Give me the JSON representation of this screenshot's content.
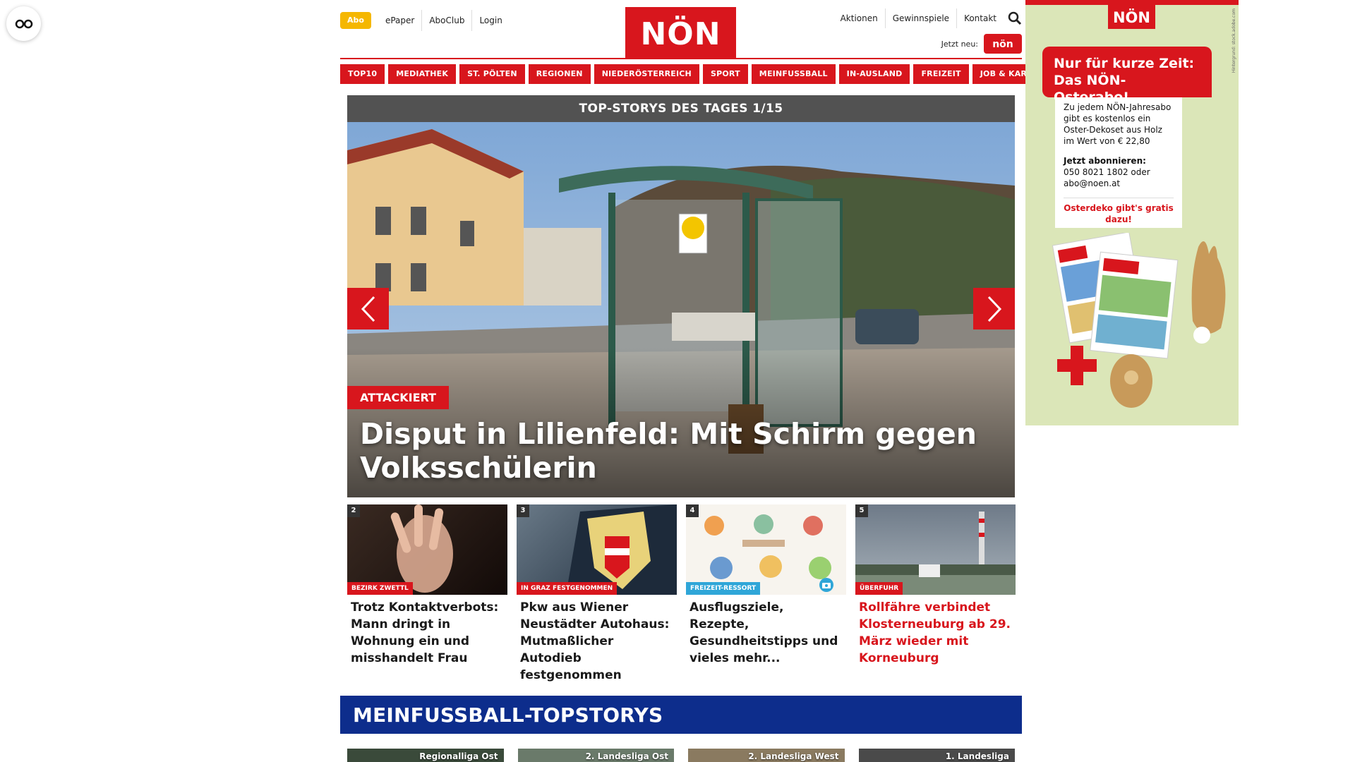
{
  "header": {
    "abo": "Abo",
    "util_links": [
      "ePaper",
      "AboClub",
      "Login"
    ],
    "logo": "NÖN",
    "right_links": [
      "Aktionen",
      "Gewinnspiele",
      "Kontakt"
    ],
    "jetzt_neu": "Jetzt neu:",
    "jetzt_badge": "nön"
  },
  "nav": [
    "TOP10",
    "MEDIATHEK",
    "ST. PÖLTEN",
    "REGIONEN",
    "NIEDERÖSTERREICH",
    "SPORT",
    "MEINFUSSBALL",
    "IN-AUSLAND",
    "FREIZEIT",
    "JOB & KARRIERE"
  ],
  "slider": {
    "heading": "TOP-STORYS DES TAGES 1/15",
    "tag": "ATTACKIERT",
    "title": "Disput in Lilienfeld: Mit Schirm gegen Volksschülerin"
  },
  "cards": [
    {
      "num": "2",
      "tag": "BEZIRK ZWETTL",
      "tag_color": "#d8161d",
      "title": "Trotz Kontaktverbots: Mann dringt in Wohnung ein und misshandelt Frau",
      "title_red": false
    },
    {
      "num": "3",
      "tag": "IN GRAZ FESTGENOMMEN",
      "tag_color": "#d8161d",
      "title": "Pkw aus Wiener Neustädter Autohaus: Mutmaßlicher Autodieb festgenommen",
      "title_red": false
    },
    {
      "num": "4",
      "tag": "FREIZEIT-RESSORT",
      "tag_color": "#2fa6d8",
      "title": "Ausflugsziele, Rezepte, Gesundheitstipps und vieles mehr...",
      "title_red": false
    },
    {
      "num": "5",
      "tag": "ÜBERFUHR",
      "tag_color": "#d8161d",
      "title": "Rollfähre verbindet Klosterneuburg ab 29. März wieder mit Korneuburg",
      "title_red": true
    }
  ],
  "meinfussball": {
    "heading": "MEINFUSSBALL-TOPSTORYS",
    "items": [
      "Regionalliga Ost",
      "2. Landesliga Ost",
      "2. Landesliga West",
      "1. Landesliga"
    ]
  },
  "ad": {
    "logo": "NÖN",
    "headline_1": "Nur für kurze Zeit:",
    "headline_2": "Das NÖN-Osterabo!",
    "body": "Zu jedem NÖN-Jahresabo gibt es kostenlos ein Oster-Dekoset aus Holz im Wert von € 22,80",
    "cta_label": "Jetzt abonnieren:",
    "cta_text": "050 8021 1802 oder abo@noen.at",
    "promo": "Osterdeko gibt's gratis dazu!",
    "side_text": "Hintergrund: stock.adobe.com"
  },
  "colors": {
    "brand_red": "#d8161d",
    "abo_yellow": "#f5b700",
    "mf_blue": "#0d2d8c"
  }
}
